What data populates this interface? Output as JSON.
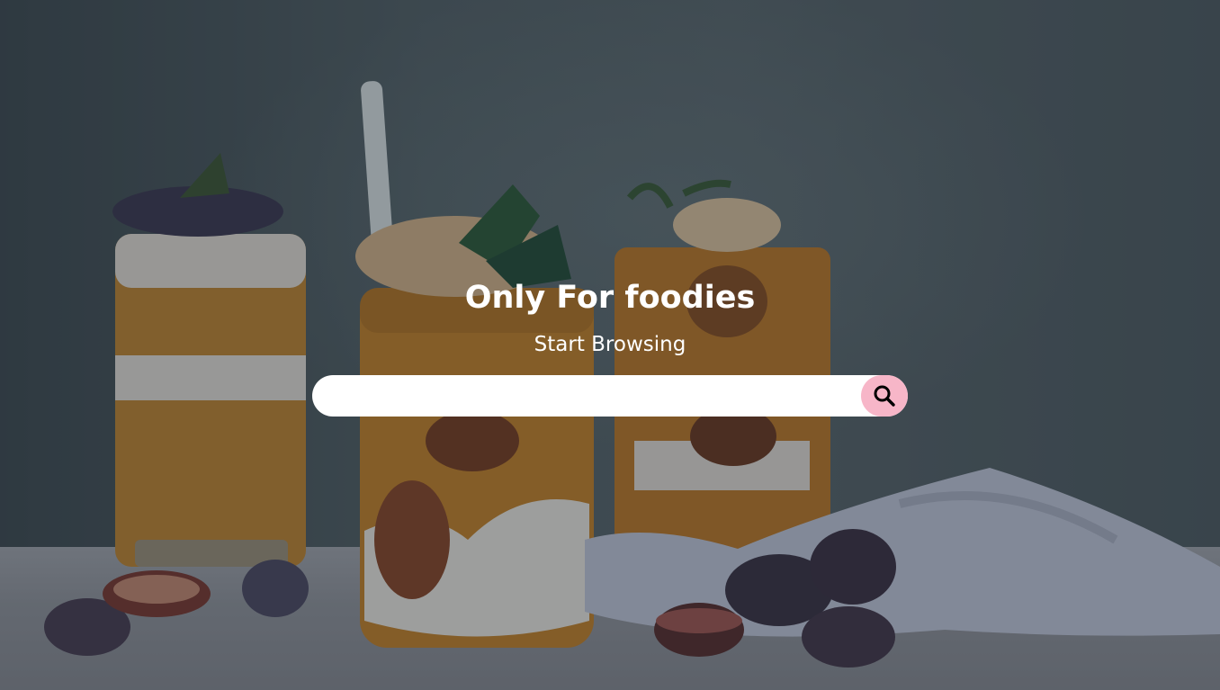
{
  "hero": {
    "title": "Only For foodies",
    "subtitle": "Start Browsing"
  },
  "search": {
    "placeholder": "",
    "value": "",
    "button_icon": "search-icon",
    "button_color": "#f7b6c8"
  },
  "background": {
    "image": "food-background-image",
    "overlay_color": "#141923"
  }
}
